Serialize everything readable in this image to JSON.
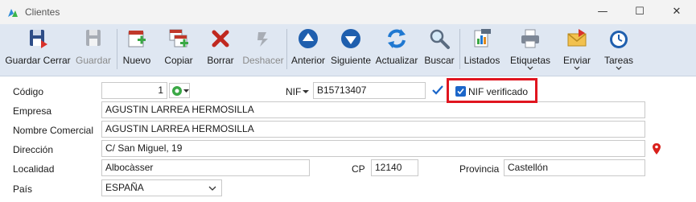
{
  "window": {
    "title": "Clientes",
    "min_glyph": "—",
    "max_glyph": "☐",
    "close_glyph": "✕"
  },
  "toolbar": {
    "guardar_cerrar": "Guardar Cerrar",
    "guardar": "Guardar",
    "nuevo": "Nuevo",
    "copiar": "Copiar",
    "borrar": "Borrar",
    "deshacer": "Deshacer",
    "anterior": "Anterior",
    "siguiente": "Siguiente",
    "actualizar": "Actualizar",
    "buscar": "Buscar",
    "listados": "Listados",
    "etiquetas": "Etiquetas",
    "enviar": "Enviar",
    "tareas": "Tareas"
  },
  "form": {
    "codigo_label": "Código",
    "codigo_value": "1",
    "nif_label": "NIF",
    "nif_value": "B15713407",
    "nif_verificado_label": "NIF verificado",
    "nif_verificado_checked": true,
    "empresa_label": "Empresa",
    "empresa_value": "AGUSTIN LARREA HERMOSILLA",
    "nombre_comercial_label": "Nombre Comercial",
    "nombre_comercial_value": "AGUSTIN LARREA HERMOSILLA",
    "direccion_label": "Dirección",
    "direccion_value": "C/ San Miguel, 19",
    "localidad_label": "Localidad",
    "localidad_value": "Albocàsser",
    "cp_label": "CP",
    "cp_value": "12140",
    "provincia_label": "Provincia",
    "provincia_value": "Castellón",
    "pais_label": "País",
    "pais_value": "ESPAÑA"
  },
  "colors": {
    "ribbon_bg": "#dfe7f2",
    "highlight": "#e0151f",
    "accent_blue": "#1b66c9"
  }
}
